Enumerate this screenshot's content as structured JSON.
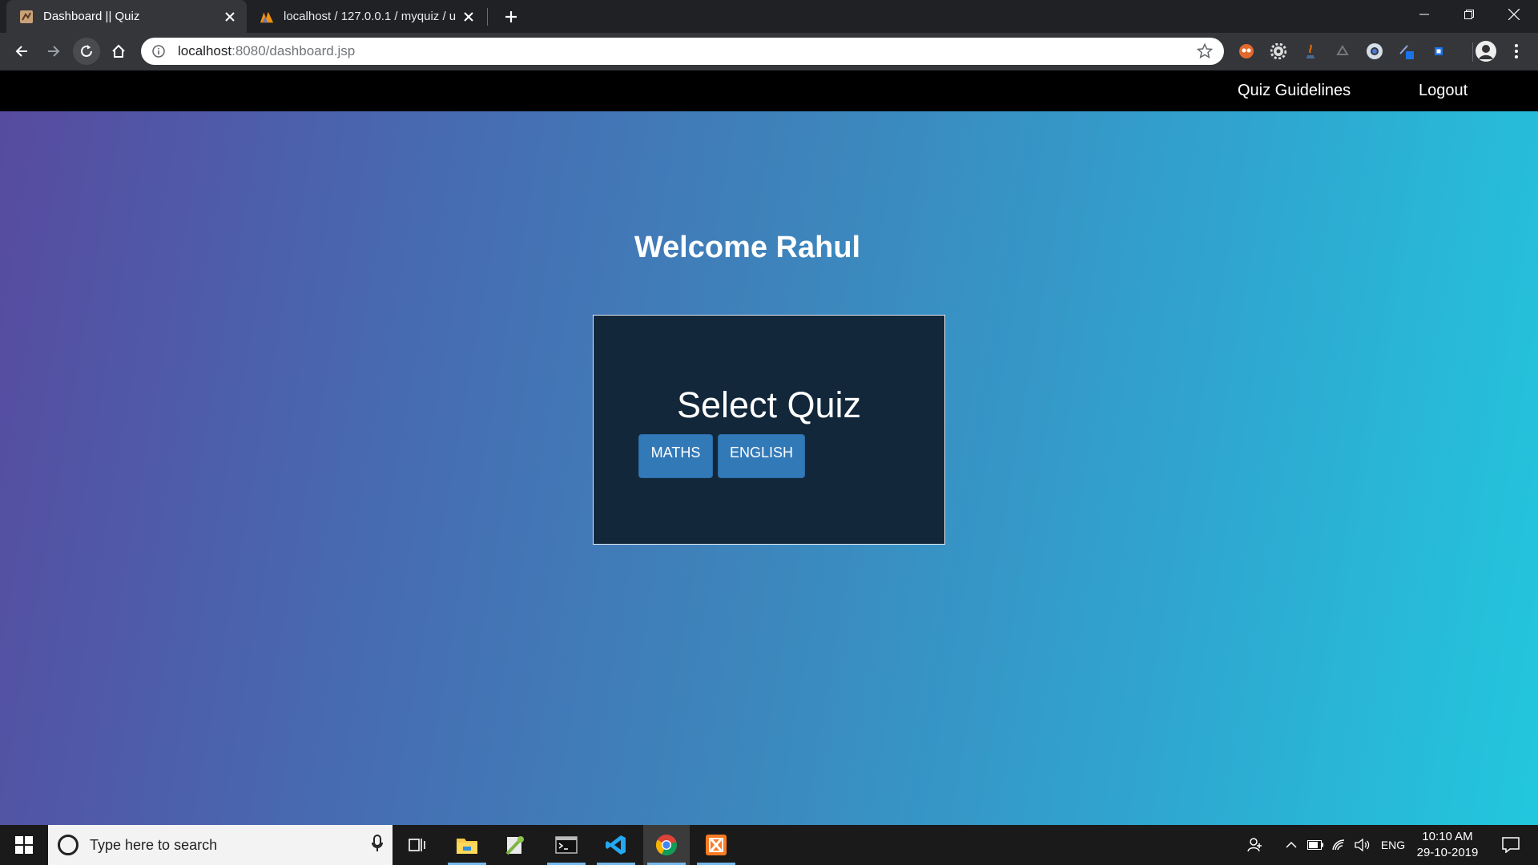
{
  "browser": {
    "tabs": [
      {
        "title": "Dashboard || Quiz",
        "active": true,
        "favicon": "quiz-favicon-icon"
      },
      {
        "title": "localhost / 127.0.0.1 / myquiz / u",
        "active": false,
        "favicon": "phpmyadmin-favicon-icon"
      }
    ],
    "url_host": "localhost",
    "url_rest": ":8080/dashboard.jsp"
  },
  "navbar": {
    "guidelines_label": "Quiz Guidelines",
    "logout_label": "Logout"
  },
  "main": {
    "welcome": "Welcome Rahul",
    "select_title": "Select Quiz",
    "quiz_buttons": [
      "MATHS",
      "ENGLISH"
    ]
  },
  "taskbar": {
    "search_placeholder": "Type here to search",
    "language": "ENG",
    "time": "10:10 AM",
    "date": "29-10-2019"
  },
  "colors": {
    "navbar_bg": "#000000",
    "quiz_box_bg": "#12273a",
    "button_bg": "#3279b8",
    "gradient_start": "#574a9f",
    "gradient_end": "#22c7de"
  }
}
